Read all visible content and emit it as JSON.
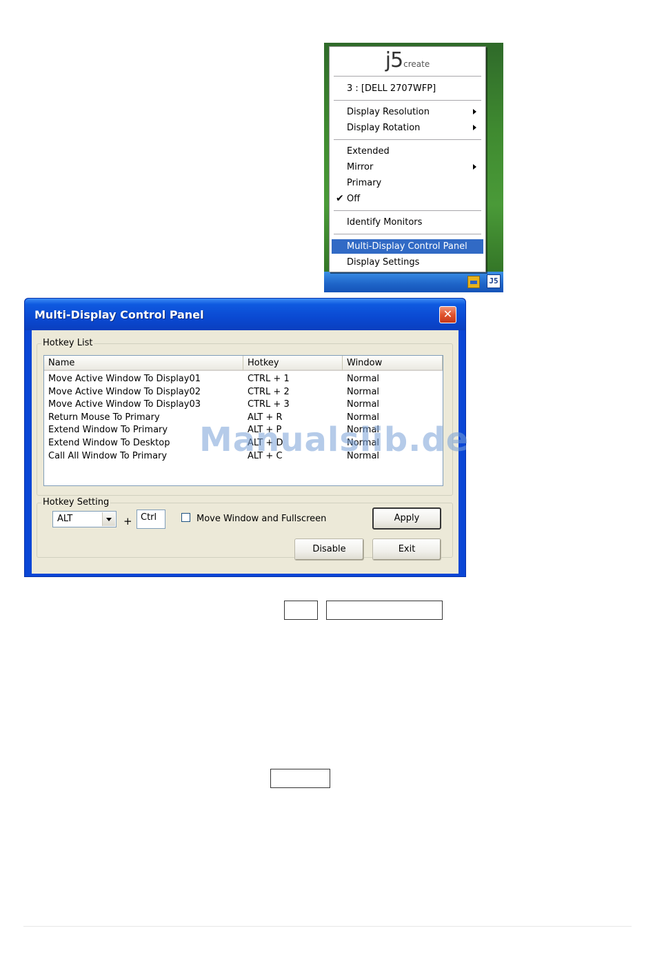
{
  "tray_menu": {
    "logo_main": "j5",
    "logo_sub": "create",
    "monitor": "3 : [DELL 2707WFP]",
    "items": [
      {
        "label": "Display Resolution",
        "submenu": true
      },
      {
        "label": "Display Rotation",
        "submenu": true
      },
      {
        "label": "Extended",
        "submenu": false
      },
      {
        "label": "Mirror",
        "submenu": true
      },
      {
        "label": "Primary",
        "submenu": false
      },
      {
        "label": "Off",
        "submenu": false,
        "checked": true
      },
      {
        "label": "Identify Monitors",
        "submenu": false
      },
      {
        "label": "Multi-Display Control Panel",
        "submenu": false,
        "highlighted": true
      },
      {
        "label": "Display Settings",
        "submenu": false
      }
    ],
    "tray_icon_label": "J5"
  },
  "dialog": {
    "title": "Multi-Display Control Panel",
    "close_glyph": "✕",
    "hotkey_list": {
      "label": "Hotkey List",
      "columns": [
        "Name",
        "Hotkey",
        "Window"
      ],
      "rows": [
        [
          "Move Active Window To Display01",
          "CTRL + 1",
          "Normal"
        ],
        [
          "Move Active Window To Display02",
          "CTRL + 2",
          "Normal"
        ],
        [
          "Move Active Window To Display03",
          "CTRL + 3",
          "Normal"
        ],
        [
          "Return Mouse To Primary",
          "ALT + R",
          "Normal"
        ],
        [
          "Extend Window To Primary",
          "ALT + P",
          "Normal"
        ],
        [
          "Extend Window To Desktop",
          "ALT + D",
          "Normal"
        ],
        [
          "Call All Window To Primary",
          "ALT + C",
          "Normal"
        ]
      ]
    },
    "hotkey_setting": {
      "label": "Hotkey Setting",
      "modifier_value": "ALT",
      "plus": "+",
      "key_value": "Ctrl",
      "checkbox_label": "Move Window and Fullscreen",
      "checkbox_checked": false,
      "apply_label": "Apply"
    },
    "buttons": {
      "disable": "Disable",
      "exit": "Exit"
    }
  },
  "watermark": "Manualslib.de",
  "colors": {
    "menu_highlight": "#316ac5",
    "titlebar": "#0a49d2",
    "dialog_face": "#ece9d8",
    "close_button": "#e0532e"
  }
}
